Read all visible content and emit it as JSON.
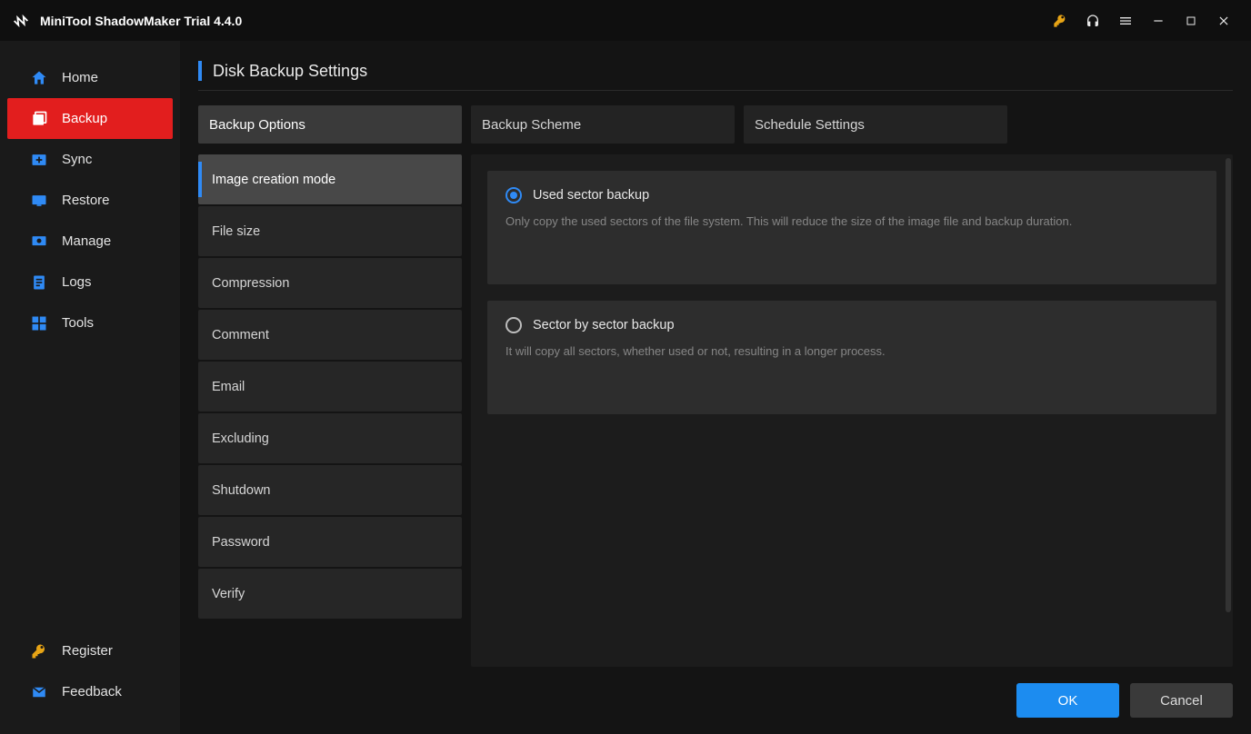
{
  "titlebar": {
    "app_title": "MiniTool ShadowMaker Trial 4.4.0"
  },
  "sidebar": {
    "items": [
      {
        "icon": "home",
        "label": "Home"
      },
      {
        "icon": "backup",
        "label": "Backup",
        "active": true
      },
      {
        "icon": "sync",
        "label": "Sync"
      },
      {
        "icon": "restore",
        "label": "Restore"
      },
      {
        "icon": "manage",
        "label": "Manage"
      },
      {
        "icon": "logs",
        "label": "Logs"
      },
      {
        "icon": "tools",
        "label": "Tools"
      }
    ],
    "bottom": [
      {
        "icon": "key",
        "label": "Register"
      },
      {
        "icon": "mail",
        "label": "Feedback"
      }
    ]
  },
  "page": {
    "title": "Disk Backup Settings"
  },
  "tabs": [
    {
      "label": "Backup Options",
      "active": true
    },
    {
      "label": "Backup Scheme"
    },
    {
      "label": "Schedule Settings"
    }
  ],
  "options": [
    {
      "label": "Image creation mode",
      "active": true
    },
    {
      "label": "File size"
    },
    {
      "label": "Compression"
    },
    {
      "label": "Comment"
    },
    {
      "label": "Email"
    },
    {
      "label": "Excluding"
    },
    {
      "label": "Shutdown"
    },
    {
      "label": "Password"
    },
    {
      "label": "Verify"
    }
  ],
  "radio_cards": [
    {
      "selected": true,
      "title": "Used sector backup",
      "desc": "Only copy the used sectors of the file system. This will reduce the size of the image file and backup duration."
    },
    {
      "selected": false,
      "title": "Sector by sector backup",
      "desc": "It will copy all sectors, whether used or not, resulting in a longer process."
    }
  ],
  "footer": {
    "ok": "OK",
    "cancel": "Cancel"
  }
}
